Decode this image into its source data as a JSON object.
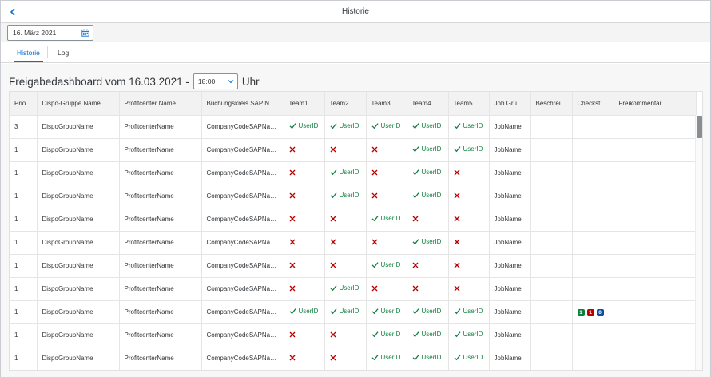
{
  "shell": {
    "title": "Historie",
    "back_icon": "nav-back-icon"
  },
  "date_picker": {
    "value": "16. März 2021",
    "icon": "calendar-icon"
  },
  "tabs": [
    {
      "label": "Historie",
      "active": true
    },
    {
      "label": "Log",
      "active": false
    }
  ],
  "heading": {
    "prefix": "Freigabedashboard vom 16.03.2021 -",
    "time_value": "18:00",
    "suffix": "Uhr"
  },
  "table": {
    "columns": [
      "Prio...",
      "Dispo-Gruppe Name",
      "Profitcenter Name",
      "Buchungskreis SAP Name",
      "Team1",
      "Team2",
      "Team3",
      "Team4",
      "Team5",
      "Job Gruppe",
      "Beschrei...",
      "Checksta...",
      "Freikommentar"
    ],
    "rows": [
      {
        "prio": "3",
        "dispo": "DispoGroupName",
        "profit": "ProfitcenterName",
        "company": "CompanyCodeSAPName",
        "teams": [
          true,
          true,
          true,
          true,
          true
        ],
        "job": "JobName",
        "checks": null
      },
      {
        "prio": "1",
        "dispo": "DispoGroupName",
        "profit": "ProfitcenterName",
        "company": "CompanyCodeSAPName",
        "teams": [
          false,
          false,
          false,
          true,
          true
        ],
        "job": "JobName",
        "checks": null
      },
      {
        "prio": "1",
        "dispo": "DispoGroupName",
        "profit": "ProfitcenterName",
        "company": "CompanyCodeSAPName",
        "teams": [
          false,
          true,
          false,
          true,
          false
        ],
        "job": "JobName",
        "checks": null
      },
      {
        "prio": "1",
        "dispo": "DispoGroupName",
        "profit": "ProfitcenterName",
        "company": "CompanyCodeSAPName",
        "teams": [
          false,
          true,
          false,
          true,
          false
        ],
        "job": "JobName",
        "checks": null
      },
      {
        "prio": "1",
        "dispo": "DispoGroupName",
        "profit": "ProfitcenterName",
        "company": "CompanyCodeSAPName",
        "teams": [
          false,
          false,
          true,
          false,
          false
        ],
        "job": "JobName",
        "checks": null
      },
      {
        "prio": "1",
        "dispo": "DispoGroupName",
        "profit": "ProfitcenterName",
        "company": "CompanyCodeSAPName",
        "teams": [
          false,
          false,
          false,
          true,
          false
        ],
        "job": "JobName",
        "checks": null
      },
      {
        "prio": "1",
        "dispo": "DispoGroupName",
        "profit": "ProfitcenterName",
        "company": "CompanyCodeSAPName",
        "teams": [
          false,
          false,
          true,
          false,
          false
        ],
        "job": "JobName",
        "checks": null
      },
      {
        "prio": "1",
        "dispo": "DispoGroupName",
        "profit": "ProfitcenterName",
        "company": "CompanyCodeSAPName",
        "teams": [
          false,
          true,
          false,
          false,
          false
        ],
        "job": "JobName",
        "checks": null
      },
      {
        "prio": "1",
        "dispo": "DispoGroupName",
        "profit": "ProfitcenterName",
        "company": "CompanyCodeSAPName",
        "teams": [
          true,
          true,
          true,
          true,
          true
        ],
        "job": "JobName",
        "checks": [
          {
            "value": "1",
            "color": "#107e3e"
          },
          {
            "value": "1",
            "color": "#bb0000"
          },
          {
            "value": "0",
            "color": "#0a4ea8"
          }
        ]
      },
      {
        "prio": "1",
        "dispo": "DispoGroupName",
        "profit": "ProfitcenterName",
        "company": "CompanyCodeSAPName",
        "teams": [
          false,
          false,
          true,
          true,
          true
        ],
        "job": "JobName",
        "checks": null
      },
      {
        "prio": "1",
        "dispo": "DispoGroupName",
        "profit": "ProfitcenterName",
        "company": "CompanyCodeSAPName",
        "teams": [
          false,
          false,
          true,
          true,
          true
        ],
        "job": "JobName",
        "checks": null
      }
    ],
    "team_ok_label": "UserID",
    "ok_icon": "checkmark-icon",
    "no_icon": "cross-icon"
  },
  "colors": {
    "accent": "#0a6ed1",
    "positive": "#107e3e",
    "negative": "#bb0000"
  }
}
